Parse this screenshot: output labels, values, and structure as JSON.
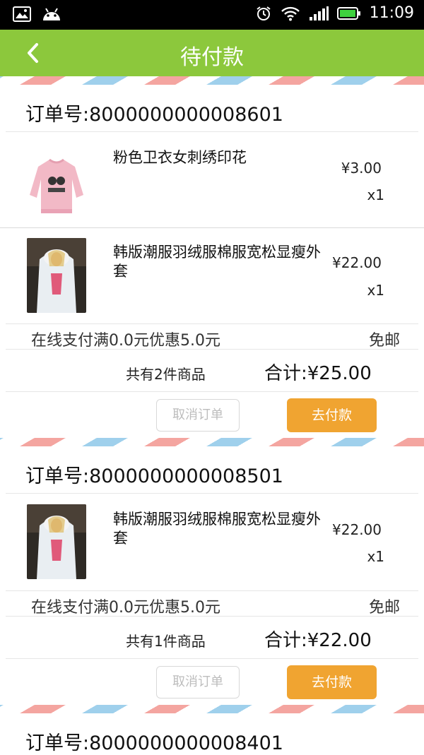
{
  "statusbar": {
    "time": "11:09"
  },
  "header": {
    "title": "待付款"
  },
  "orders": [
    {
      "order_no": "订单号:8000000000008601",
      "items": [
        {
          "name": "粉色卫衣女刺绣印花",
          "price": "¥3.00",
          "qty": "x1"
        },
        {
          "name": "韩版潮服羽绒服棉服宽松显瘦外套",
          "price": "¥22.00",
          "qty": "x1"
        }
      ],
      "promo": "在线支付满0.0元优惠5.0元",
      "shipping": "免邮",
      "count": "共有2件商品",
      "total": "合计:¥25.00",
      "cancel_label": "取消订单",
      "pay_label": "去付款"
    },
    {
      "order_no": "订单号:8000000000008501",
      "items": [
        {
          "name": "韩版潮服羽绒服棉服宽松显瘦外套",
          "price": "¥22.00",
          "qty": "x1"
        }
      ],
      "promo": "在线支付满0.0元优惠5.0元",
      "shipping": "免邮",
      "count": "共有1件商品",
      "total": "合计:¥22.00",
      "cancel_label": "取消订单",
      "pay_label": "去付款"
    },
    {
      "order_no": "订单号:8000000000008401"
    }
  ]
}
